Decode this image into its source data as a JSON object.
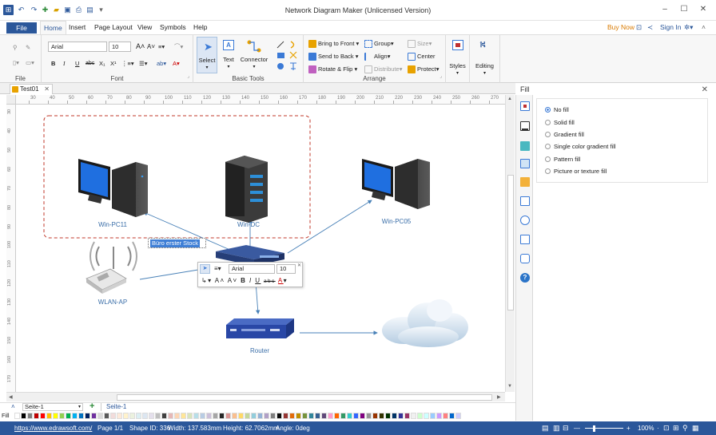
{
  "app": {
    "title": "Network Diagram Maker (Unlicensed Version)"
  },
  "window": {
    "minimize": "–",
    "maximize": "☐",
    "close": "✕"
  },
  "menu": {
    "file": "File",
    "items": [
      "Home",
      "Insert",
      "Page Layout",
      "View",
      "Symbols",
      "Help"
    ],
    "buy_now": "Buy Now",
    "sign_in": "Sign In"
  },
  "ribbon": {
    "file_group": "File",
    "font_group": "Font",
    "font_name": "Arial",
    "font_size": "10",
    "basic_tools_group": "Basic Tools",
    "select": "Select",
    "text": "Text",
    "connector": "Connector",
    "arrange_group": "Arrange",
    "bring_to_front": "Bring to Front",
    "send_to_back": "Send to Back",
    "rotate_flip": "Rotate & Flip",
    "group": "Group",
    "align": "Align",
    "distribute": "Distribute",
    "size": "Size",
    "center": "Center",
    "protect": "Protect",
    "styles": "Styles",
    "editing": "Editing"
  },
  "document": {
    "tab": "Test01"
  },
  "ruler": {
    "h": [
      "30",
      "40",
      "50",
      "60",
      "70",
      "80",
      "90",
      "100",
      "110",
      "120",
      "130",
      "140",
      "150",
      "160",
      "170",
      "180",
      "190",
      "200",
      "210",
      "220",
      "230",
      "240",
      "250",
      "260",
      "270"
    ],
    "v": [
      "30",
      "40",
      "50",
      "60",
      "70",
      "80",
      "90",
      "100",
      "110",
      "120",
      "130",
      "140",
      "150",
      "160",
      "170"
    ]
  },
  "diagram": {
    "pc1": "Win-PC11",
    "dc": "Win-DC",
    "pc2": "Win-PC05",
    "wlan": "WLAN-AP",
    "router": "Router",
    "editing_text": "Büro erster Stock"
  },
  "mini_toolbar": {
    "font": "Arial",
    "size": "10"
  },
  "pages": {
    "current": "Seite-1",
    "tab": "Seite-1",
    "add": "+"
  },
  "colorbar": {
    "label": "Fill"
  },
  "fill_panel": {
    "title": "Fill",
    "options": [
      "No fill",
      "Solid fill",
      "Gradient fill",
      "Single color gradient fill",
      "Pattern fill",
      "Picture or texture fill"
    ]
  },
  "status": {
    "url": "https://www.edrawsoft.com/",
    "page": "Page 1/1",
    "shape_id": "Shape ID: 336",
    "width": "Width: 137.583mm",
    "height": "Height: 62.7062mm",
    "angle": "Angle: 0deg",
    "zoom": "100%"
  },
  "colors": {
    "accent": "#2b579a",
    "link": "#3a6ea8",
    "dash": "#c0392b"
  },
  "palette": [
    "#ffffff",
    "#000000",
    "#7f7f7f",
    "#c00000",
    "#ff0000",
    "#ffc000",
    "#ffff00",
    "#92d050",
    "#00b050",
    "#00b0f0",
    "#0070c0",
    "#002060",
    "#7030a0",
    "#d9d9d9",
    "#595959",
    "#f2dcdb",
    "#fde9d9",
    "#fff2cc",
    "#ebf1de",
    "#dbeef3",
    "#dce6f1",
    "#e4dfec",
    "#bfbfbf",
    "#404040",
    "#e6b8b7",
    "#fcd5b4",
    "#ffe699",
    "#d8e4bc",
    "#b7dee8",
    "#b8cce4",
    "#ccc0da",
    "#a6a6a6",
    "#262626",
    "#da9694",
    "#fabf8f",
    "#ffd966",
    "#c4d79b",
    "#92cddc",
    "#95b3d7",
    "#b1a0c7",
    "#808080",
    "#0d0d0d",
    "#963634",
    "#e26b0a",
    "#bf8f00",
    "#76933c",
    "#31869b",
    "#366092",
    "#60497a",
    "#ff99cc",
    "#ff6600",
    "#339966",
    "#33cccc",
    "#3366ff",
    "#800080",
    "#969696",
    "#993300",
    "#333300",
    "#003300",
    "#003366",
    "#333399",
    "#993366",
    "#f0f0f0",
    "#ccffcc",
    "#ccffff",
    "#99ccff",
    "#cc99ff",
    "#ff8080",
    "#0066cc",
    "#ccccff"
  ]
}
